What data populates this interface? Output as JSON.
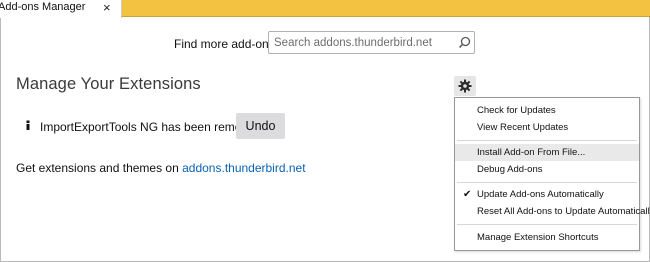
{
  "tab": {
    "title": "Add-ons Manager",
    "close": "×"
  },
  "header": {
    "find_label": "Find more add-ons",
    "search_placeholder": "Search addons.thunderbird.net"
  },
  "main": {
    "title": "Manage Your Extensions",
    "notice": "ImportExportTools NG has been removed.",
    "undo_label": "Undo",
    "get_ext_prefix": "Get extensions and themes on ",
    "get_ext_link": "addons.thunderbird.net"
  },
  "menu": {
    "items": [
      {
        "label": "Check for Updates"
      },
      {
        "label": "View Recent Updates"
      },
      {
        "label": "Install Add-on From File..."
      },
      {
        "label": "Debug Add-ons"
      },
      {
        "label": "Update Add-ons Automatically",
        "checked": true
      },
      {
        "label": "Reset All Add-ons to Update Automatically"
      },
      {
        "label": "Manage Extension Shortcuts"
      }
    ],
    "checkmark": "✔"
  },
  "colors": {
    "tabstrip": "#f2c240",
    "link": "#0a62b6"
  }
}
